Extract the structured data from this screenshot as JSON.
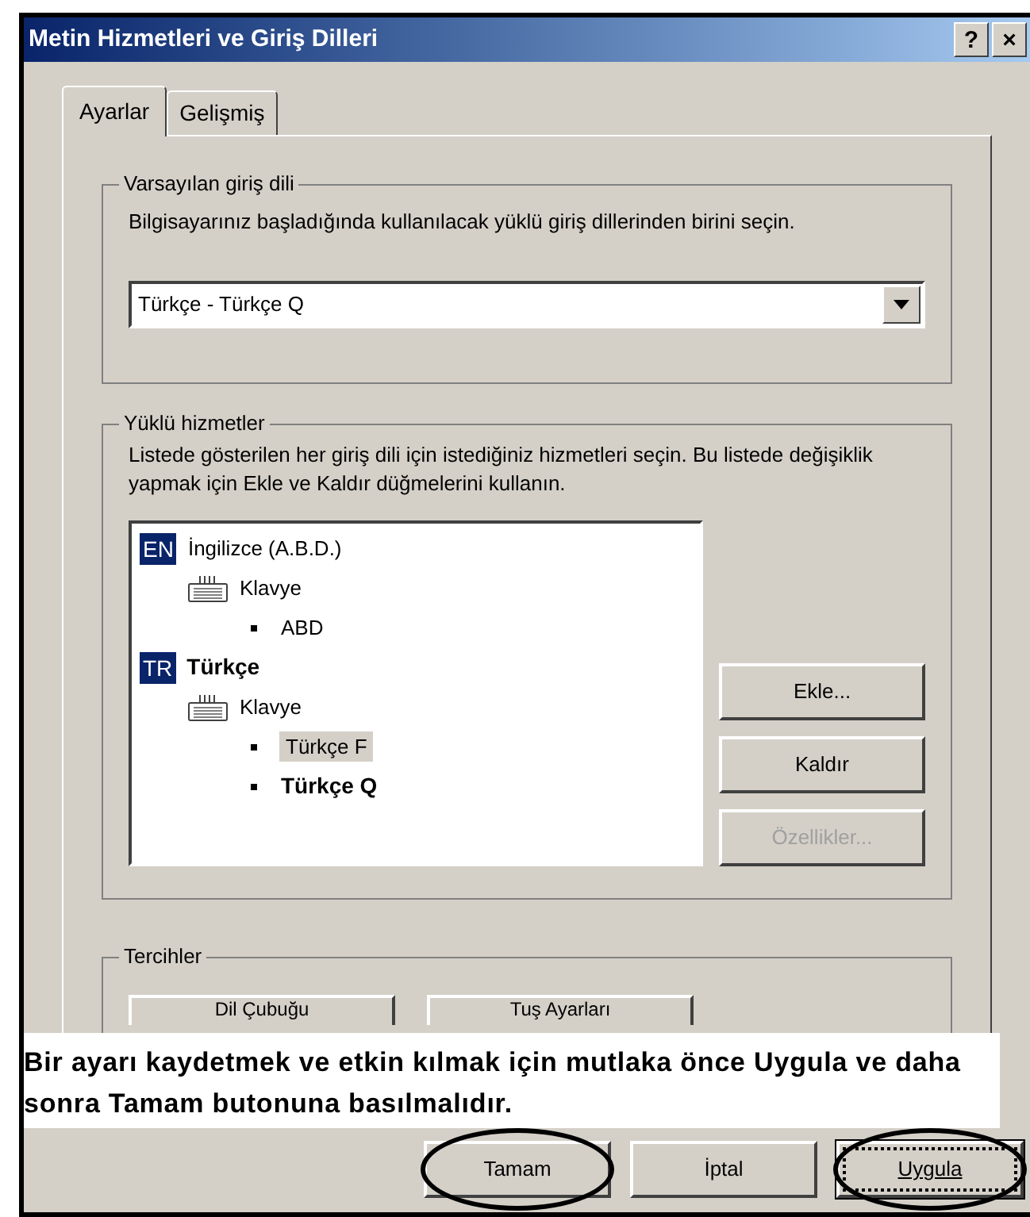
{
  "window": {
    "title": "Metin Hizmetleri ve Giriş Dilleri",
    "title_buttons": [
      "?",
      "×"
    ]
  },
  "tabs": [
    {
      "label": "Ayarlar",
      "selected": true
    },
    {
      "label": "Gelişmiş",
      "selected": false
    }
  ],
  "default_language": {
    "legend": "Varsayılan giriş dili",
    "description": "Bilgisayarınız başladığında kullanılacak yüklü giriş dillerinden birini seçin.",
    "value": "Türkçe - Türkçe Q"
  },
  "installed_services": {
    "legend": "Yüklü hizmetler",
    "description": "Listede gösterilen her giriş dili için istediğiniz hizmetleri seçin. Bu listede değişiklik yapmak için Ekle ve Kaldır düğmelerini kullanın.",
    "tree": [
      {
        "kind": "language",
        "badge": "EN",
        "label": "İngilizce (A.B.D.)",
        "bold": false,
        "selected": false,
        "children": [
          {
            "kind": "category",
            "label": "Klavye",
            "bold": false,
            "selected": false,
            "children": [
              {
                "kind": "layout",
                "label": "ABD",
                "bold": false,
                "selected": false
              }
            ]
          }
        ]
      },
      {
        "kind": "language",
        "badge": "TR",
        "label": "Türkçe",
        "bold": true,
        "selected": false,
        "children": [
          {
            "kind": "category",
            "label": "Klavye",
            "bold": false,
            "selected": false,
            "children": [
              {
                "kind": "layout",
                "label": "Türkçe F",
                "bold": false,
                "selected": true
              },
              {
                "kind": "layout",
                "label": "Türkçe Q",
                "bold": true,
                "selected": false
              }
            ]
          }
        ]
      }
    ],
    "buttons": [
      {
        "label": "Ekle...",
        "disabled": false
      },
      {
        "label": "Kaldır",
        "disabled": false
      },
      {
        "label": "Özellikler...",
        "disabled": true
      }
    ]
  },
  "preferences": {
    "legend": "Tercihler",
    "buttons": [
      "Dil Çubuğu",
      "Tuş Ayarları"
    ]
  },
  "annotation": "Bir ayarı kaydetmek ve etkin kılmak için mutlaka önce Uygula ve daha sonra Tamam butonuna basılmalıdır.",
  "dialog_buttons": [
    {
      "label": "Tamam",
      "circled": true,
      "focused": false
    },
    {
      "label": "İptal",
      "circled": false,
      "focused": false
    },
    {
      "label": "Uygula",
      "circled": true,
      "focused": true
    }
  ]
}
